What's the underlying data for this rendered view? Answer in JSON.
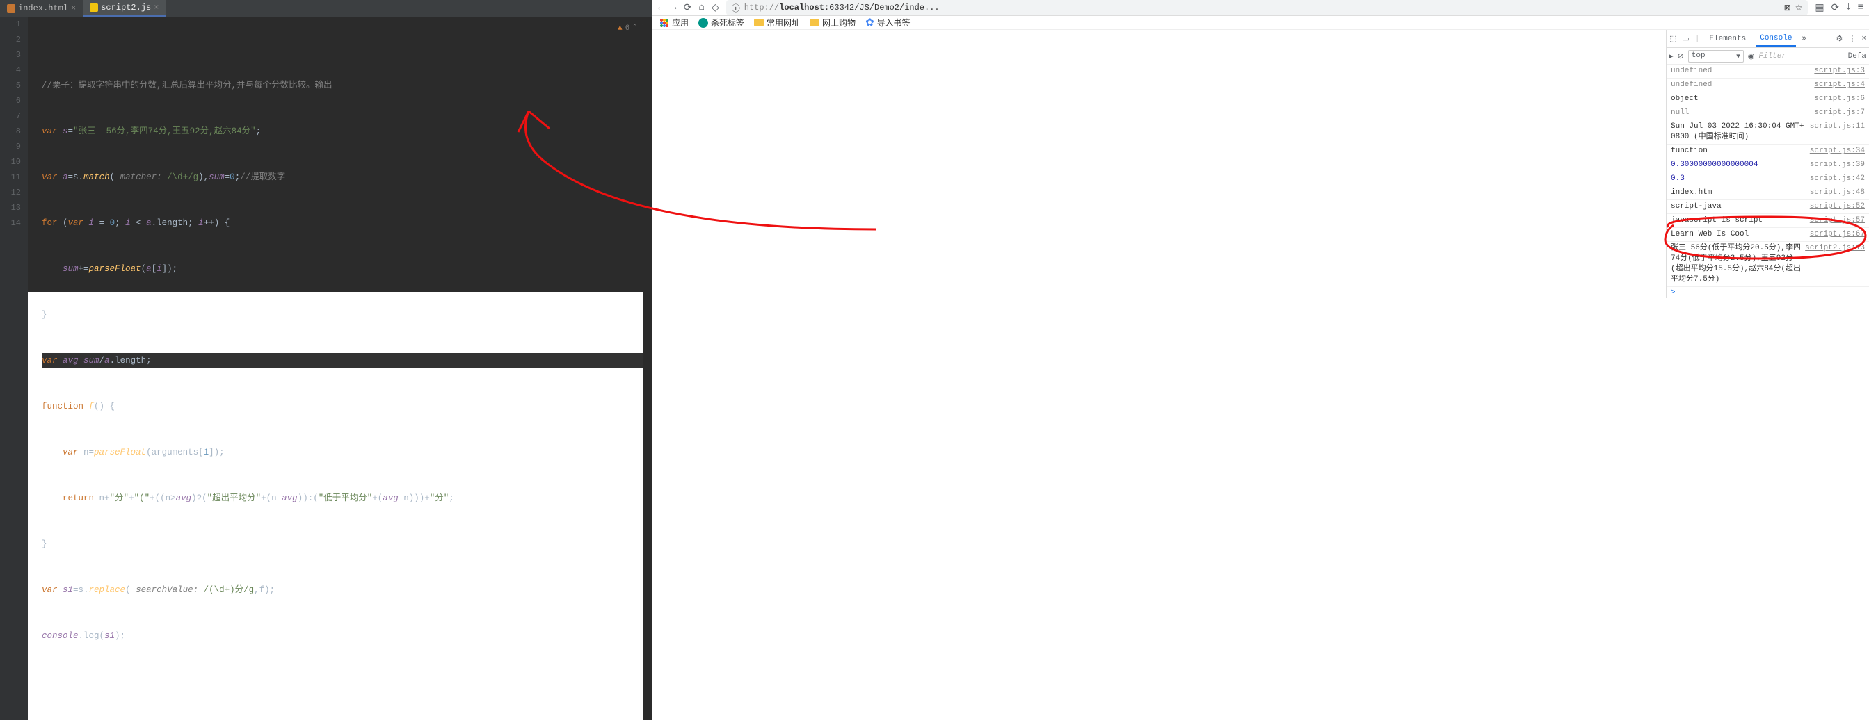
{
  "editor": {
    "tabs": [
      {
        "label": "index.html",
        "active": false
      },
      {
        "label": "script2.js",
        "active": true
      }
    ],
    "hint_count": "6",
    "gutter": [
      "1",
      "2",
      "3",
      "4",
      "5",
      "6",
      "7",
      "8",
      "9",
      "10",
      "11",
      "12",
      "13",
      "14"
    ],
    "code": {
      "l1": "//栗子：提取字符串中的分数,汇总后算出平均分,并与每个分数比较。输出",
      "l2_kw": "var",
      "l2_var": "s",
      "l2_eq": "=",
      "l2_str": "\"张三  56分,李四74分,王五92分,赵六84分\"",
      "l2_end": ";",
      "l3_kw": "var",
      "l3_var": "a",
      "l3_eq": "=s.",
      "l3_m": "match",
      "l3_p1": "( ",
      "l3_lbl": "matcher: ",
      "l3_rx": "/\\d+/g",
      "l3_p2": "),",
      "l3_var2": "sum",
      "l3_eq2": "=",
      "l3_n": "0",
      "l3_end": ";",
      "l3_cm": "//提取数字",
      "l4_kw": "for",
      "l4_p": " (",
      "l4_kw2": "var",
      "l4_var": " i ",
      "l4_eq": "= ",
      "l4_n": "0",
      "l4_s": "; ",
      "l4_var2": "i ",
      "l4_lt": "< ",
      "l4_var3": "a",
      "l4_len": ".length; ",
      "l4_var4": "i",
      "l4_pp": "++)",
      "l4_br": " {",
      "l5_var": "sum",
      "l5_op": "+=",
      "l5_fn": "parseFloat",
      "l5_p": "(",
      "l5_var2": "a",
      "l5_idx": "[",
      "l5_var3": "i",
      "l5_idx2": "]);",
      "l6": "}",
      "l7_kw": "var",
      "l7_var": " avg",
      "l7_eq": "=",
      "l7_var2": "sum",
      "l7_sl": "/",
      "l7_var3": "a",
      "l7_len": ".length;",
      "l8_kw": "function",
      "l8_fn": " f",
      "l8_p": "() {",
      "l9_kw": "var",
      "l9_n": " n=",
      "l9_fn": "parseFloat",
      "l9_p": "(arguments[",
      "l9_num": "1",
      "l9_p2": "]);",
      "l10_kw": "return",
      "l10_a": " n+",
      "l10_s1": "\"分\"",
      "l10_b": "+",
      "l10_s2": "\"(\"",
      "l10_c": "+((n>",
      "l10_v": "avg",
      "l10_d": ")?(",
      "l10_s3": "\"超出平均分\"",
      "l10_e": "+(n-",
      "l10_v2": "avg",
      "l10_f": ")):(",
      "l10_s4": "\"低于平均分\"",
      "l10_g": "+(",
      "l10_v3": "avg",
      "l10_h": "-n)))+",
      "l10_s5": "\"分\"",
      "l10_i": ";",
      "l11": "}",
      "l12_kw": "var",
      "l12_var": " s1",
      "l12_eq": "=s.",
      "l12_fn": "replace",
      "l12_p": "( ",
      "l12_lbl": "searchValue: ",
      "l12_rx": "/(\\d+)分/g",
      "l12_c": ",f);",
      "l13_c": "console",
      "l13_m": ".log(",
      "l13_v": "s1",
      "l13_e": ");"
    }
  },
  "browser": {
    "url_prefix": "http://",
    "url_host": "localhost",
    "url_rest": ":63342/JS/Demo2/inde...",
    "bookmarks": {
      "apps": "应用",
      "kill": "杀死标签",
      "common": "常用网址",
      "shop": "网上购物",
      "import": "导入书签"
    },
    "devtools": {
      "tab_elements": "Elements",
      "tab_console": "Console",
      "sub_top": "top",
      "sub_filter": "Filter",
      "sub_defa": "Defa",
      "rows": [
        {
          "msg": "undefined",
          "cls": "undef",
          "src": "script.js:3"
        },
        {
          "msg": "undefined",
          "cls": "undef",
          "src": "script.js:4"
        },
        {
          "msg": "object",
          "cls": "",
          "src": "script.js:6"
        },
        {
          "msg": "null",
          "cls": "undef",
          "src": "script.js:7"
        },
        {
          "msg": "Sun Jul 03 2022 16:30:04 GMT+0800 (中国标准时间)",
          "cls": "",
          "src": "script.js:11"
        },
        {
          "msg": "function",
          "cls": "",
          "src": "script.js:34"
        },
        {
          "msg": "0.30000000000000004",
          "cls": "num",
          "src": "script.js:39"
        },
        {
          "msg": "0.3",
          "cls": "num",
          "src": "script.js:42"
        },
        {
          "msg": "index.htm",
          "cls": "",
          "src": "script.js:48"
        },
        {
          "msg": "script-java",
          "cls": "",
          "src": "script.js:52"
        },
        {
          "msg": "javascript is script",
          "cls": "",
          "src": "script.js:57"
        },
        {
          "msg": "Learn Web Is Cool",
          "cls": "",
          "src": "script.js:67"
        },
        {
          "msg": "张三  56分(低于平均分20.5分),李四74分(低于平均分2.5分),王五92分(超出平均分15.5分),赵六84分(超出平均分7.5分)",
          "cls": "",
          "src": "script2.js:13"
        }
      ],
      "prompt": " >"
    }
  }
}
